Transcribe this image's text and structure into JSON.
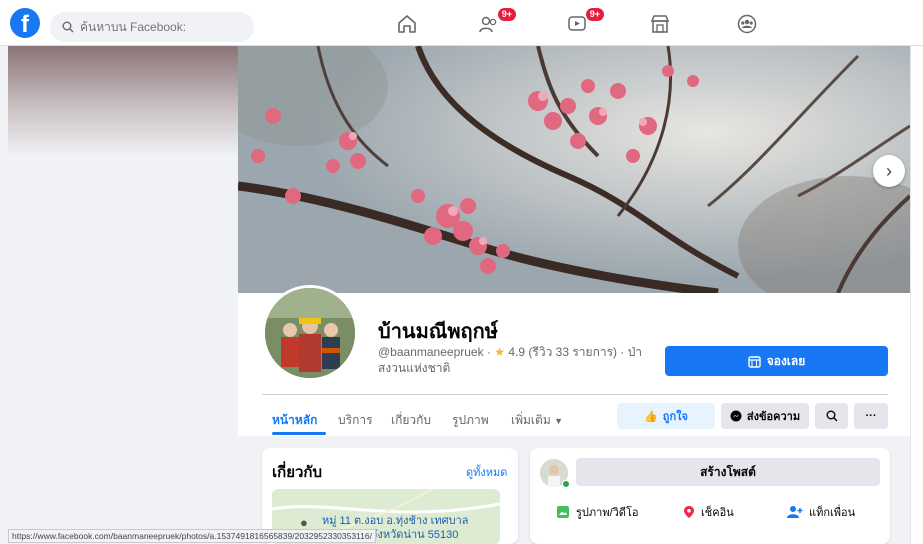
{
  "header": {
    "logo_letter": "f",
    "search_placeholder": "ค้นหาบน Facebook:",
    "badges": {
      "friends": "9+",
      "watch": "9+"
    }
  },
  "page": {
    "name": "บ้านมณีพฤกษ์",
    "handle": "@baanmaneepruek",
    "rating": "4.9",
    "reviews": "(รีวิว 33 รายการ)",
    "category": "· ป่าสงวนแห่งชาติ",
    "book_label": "จองเลย"
  },
  "tabs": [
    {
      "label": "หน้าหลัก",
      "active": true
    },
    {
      "label": "บริการ"
    },
    {
      "label": "เกี่ยวกับ"
    },
    {
      "label": "รูปภาพ"
    },
    {
      "label": "เพิ่มเติม"
    }
  ],
  "actions": {
    "like": "ถูกใจ",
    "message": "ส่งข้อความ"
  },
  "about": {
    "title": "เกี่ยวกับ",
    "see_all": "ดูทั้งหมด",
    "address_line1": "หมู่ 11 ต.งอบ อ.ทุ่งช้าง เทศบาล",
    "address_line2": "ตำบลงอบ จังหวัดน่าน 55130"
  },
  "composer": {
    "create_post": "สร้างโพสต์",
    "photo_video": "รูปภาพ/วิดีโอ",
    "check_in": "เช็คอิน",
    "tag_friends": "แท็กเพื่อน"
  },
  "status_url": "https://www.facebook.com/baanmaneepruek/photos/a.1537491816565839/2032952330353116/",
  "colors": {
    "brand_blue": "#1877f2",
    "background": "#f0f2f5",
    "badge_red": "#e41e3f"
  }
}
